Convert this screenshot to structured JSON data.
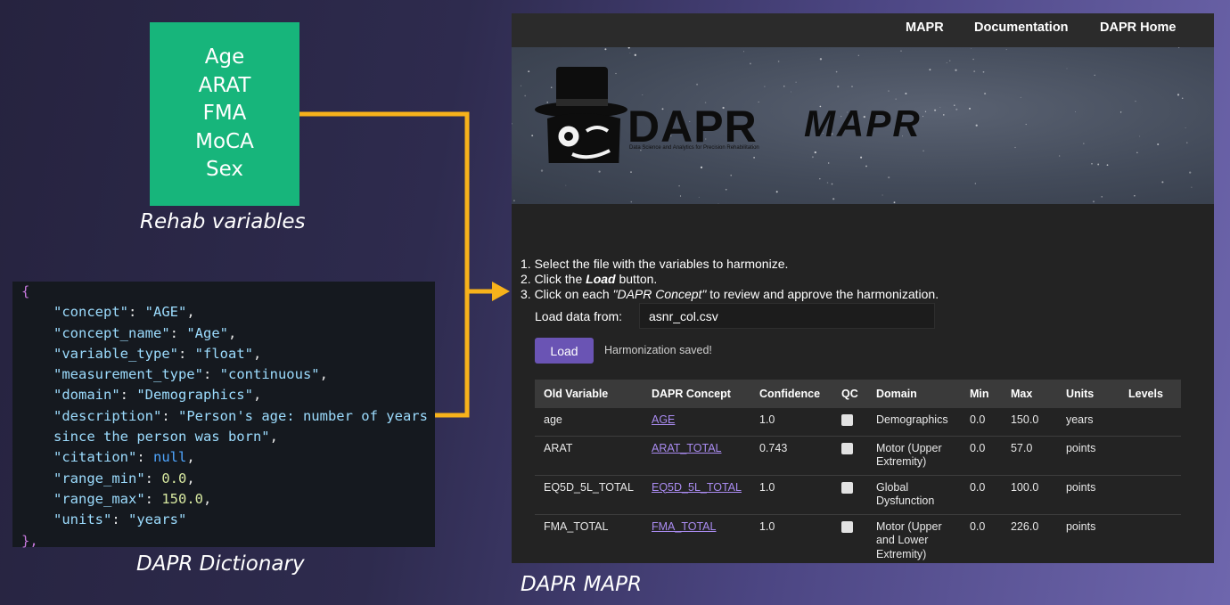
{
  "rehab": {
    "variables": [
      "Age",
      "ARAT",
      "FMA",
      "MoCA",
      "Sex"
    ],
    "caption": "Rehab variables"
  },
  "dictionary": {
    "caption": "DAPR Dictionary",
    "open_brace": "{",
    "close_brace": "},",
    "entries": [
      {
        "key": "\"concept\"",
        "value": "\"AGE\"",
        "kind": "s",
        "comma": ","
      },
      {
        "key": "\"concept_name\"",
        "value": "\"Age\"",
        "kind": "s",
        "comma": ","
      },
      {
        "key": "\"variable_type\"",
        "value": "\"float\"",
        "kind": "s",
        "comma": ","
      },
      {
        "key": "\"measurement_type\"",
        "value": "\"continuous\"",
        "kind": "s",
        "comma": ","
      },
      {
        "key": "\"domain\"",
        "value": "\"Demographics\"",
        "kind": "s",
        "comma": ","
      },
      {
        "key": "\"description\"",
        "value": "\"Person's age: number of years",
        "kind": "s",
        "comma": ""
      },
      {
        "key": "",
        "value": "since the person was born\"",
        "kind": "s",
        "comma": ",",
        "continuation": true
      },
      {
        "key": "\"citation\"",
        "value": "null",
        "kind": "nl",
        "comma": ","
      },
      {
        "key": "\"range_min\"",
        "value": "0.0",
        "kind": "n",
        "comma": ","
      },
      {
        "key": "\"range_max\"",
        "value": "150.0",
        "kind": "n",
        "comma": ","
      },
      {
        "key": "\"units\"",
        "value": "\"years\"",
        "kind": "s",
        "comma": ""
      }
    ]
  },
  "mapr": {
    "caption": "DAPR MAPR",
    "nav": [
      "MAPR",
      "Documentation",
      "DAPR Home"
    ],
    "brand": {
      "name": "DAPR",
      "product": "MAPR",
      "subtitle": "Data Science and Analytics for Precision Rehabilitation"
    },
    "steps": {
      "s1": "1. Select the file with the variables to harmonize.",
      "s2_pre": "2. Click the ",
      "s2_bold": "Load",
      "s2_post": " button.",
      "s3_pre": "3. Click on each ",
      "s3_italic": "\"DAPR Concept\"",
      "s3_post": " to review and approve the harmonization."
    },
    "load_label": "Load data from:",
    "file_value": "asnr_col.csv",
    "load_button": "Load",
    "saved_message": "Harmonization saved!",
    "table": {
      "columns": [
        "Old Variable",
        "DAPR Concept",
        "Confidence",
        "QC",
        "Domain",
        "Min",
        "Max",
        "Units",
        "Levels"
      ],
      "rows": [
        {
          "old": "age",
          "concept": "AGE",
          "confidence": "1.0",
          "domain": "Demographics",
          "min": "0.0",
          "max": "150.0",
          "units": "years",
          "levels": ""
        },
        {
          "old": "ARAT",
          "concept": "ARAT_TOTAL",
          "confidence": "0.743",
          "domain": "Motor (Upper Extremity)",
          "min": "0.0",
          "max": "57.0",
          "units": "points",
          "levels": ""
        },
        {
          "old": "EQ5D_5L_TOTAL",
          "concept": "EQ5D_5L_TOTAL",
          "confidence": "1.0",
          "domain": "Global Dysfunction",
          "min": "0.0",
          "max": "100.0",
          "units": "points",
          "levels": ""
        },
        {
          "old": "FMA_TOTAL",
          "concept": "FMA_TOTAL",
          "confidence": "1.0",
          "domain": "Motor (Upper and Lower Extremity)",
          "min": "0.0",
          "max": "226.0",
          "units": "points",
          "levels": ""
        }
      ]
    }
  },
  "colors": {
    "connector": "#f7b21b",
    "box": "#17b57b",
    "button": "#6a54b4",
    "link": "#a98bf0",
    "confidence": "#41c272"
  }
}
